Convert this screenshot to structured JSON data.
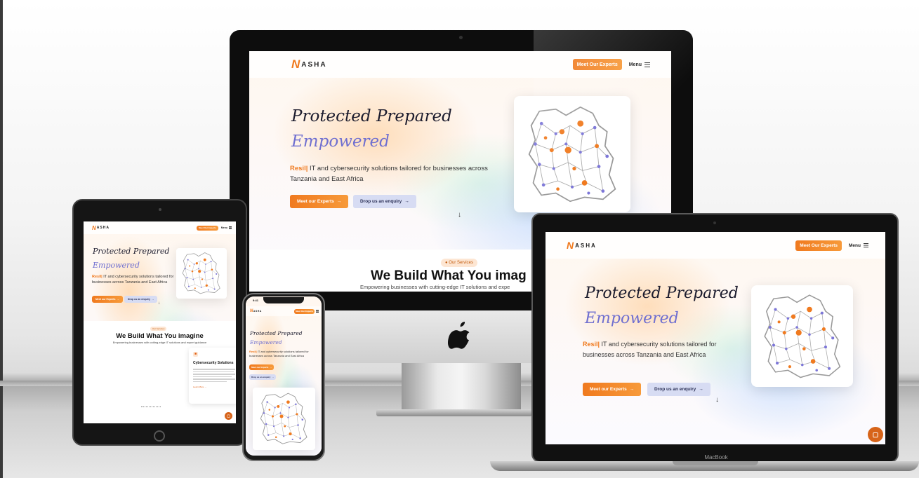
{
  "site": {
    "logo_text": "ASHA",
    "logo_mark": "N",
    "nav_button": "Meet Our Experts",
    "menu_label": "Menu",
    "heading_line1": "Protected Prepared",
    "heading_line2": "Empowered",
    "typed_prefix": "Resil|",
    "description": " IT and cybersecurity solutions tailored for businesses across Tanzania and East Africa",
    "primary_button": "Meet our Experts",
    "secondary_button": "Drop us an enquiry",
    "services_badge": "Our Services",
    "services_heading": "We Build What You imagine",
    "services_heading_cut": "We Build What You imag",
    "services_sub": "Empowering businesses with cutting-edge IT solutions and expert guidance",
    "services_sub_cut": "Empowering businesses with cutting-edge IT solutions and expe",
    "card_title": "Cybersecurity Solutions",
    "card_link": "Learn More"
  },
  "devices": {
    "macbook_label": "MacBook",
    "phone_time": "9:41"
  },
  "icons": {
    "arrow_right": "→",
    "arrow_down": "↓",
    "chat": "chat-icon",
    "apple": "apple-logo-icon"
  },
  "colors": {
    "accent": "#f07a1f",
    "heading_purple": "#6f6fd0",
    "lavender_button": "#d7dcf3"
  }
}
